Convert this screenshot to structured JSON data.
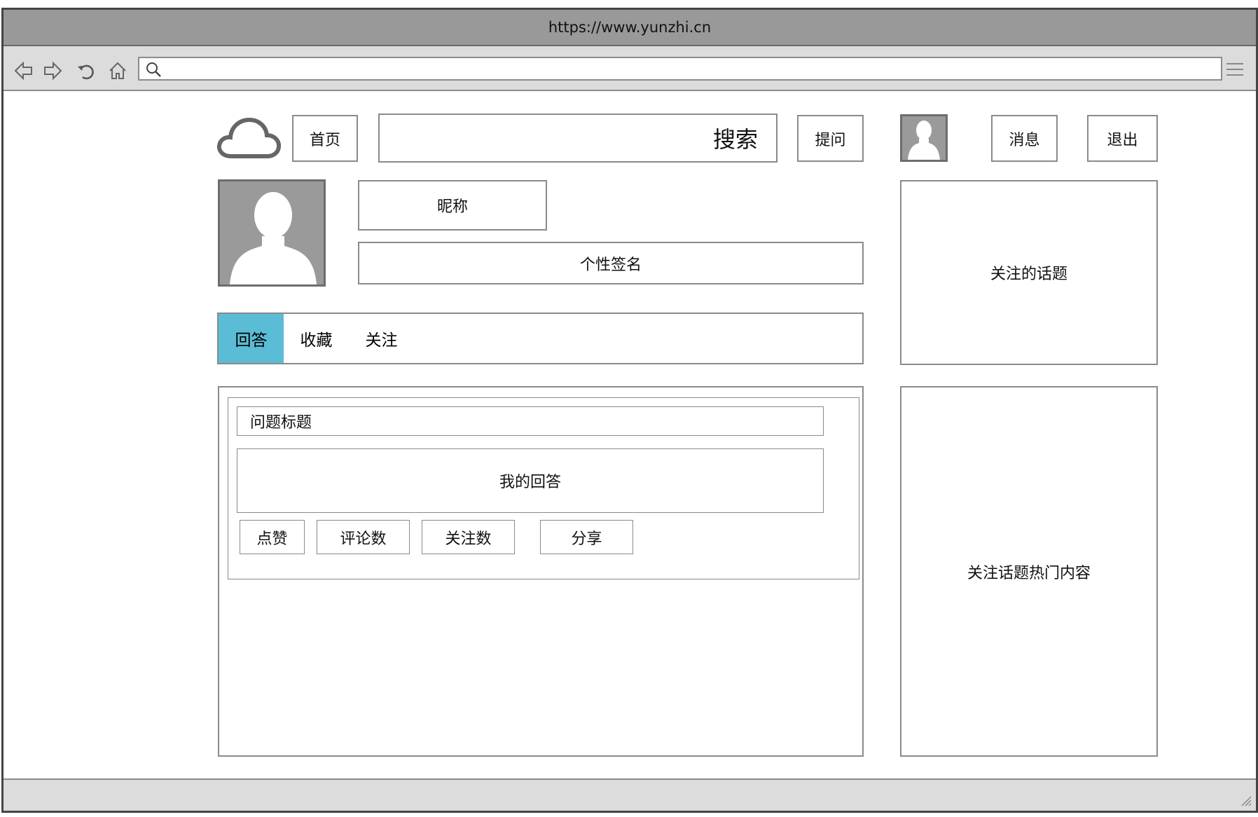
{
  "browser": {
    "url": "https://www.yunzhi.cn",
    "icons": [
      "back-icon",
      "forward-icon",
      "reload-icon",
      "home-icon",
      "search-icon",
      "menu-icon"
    ]
  },
  "header": {
    "home_label": "首页",
    "search_label": "搜索",
    "ask_label": "提问",
    "messages_label": "消息",
    "logout_label": "退出"
  },
  "profile": {
    "nickname": "昵称",
    "signature": "个性签名"
  },
  "tabs": [
    {
      "label": "回答",
      "active": true
    },
    {
      "label": "收藏",
      "active": false
    },
    {
      "label": "关注",
      "active": false
    }
  ],
  "answer_card": {
    "question_title": "问题标题",
    "my_answer": "我的回答",
    "actions": [
      "点赞",
      "评论数",
      "关注数",
      "分享"
    ]
  },
  "sidebar": {
    "followed_topics": "关注的话题",
    "hot_content": "关注话题热门内容"
  },
  "colors": {
    "chrome": "#999999",
    "toolbar": "#dcdcdc",
    "active_tab": "#5bbcd6",
    "border": "#8a8a8a"
  }
}
